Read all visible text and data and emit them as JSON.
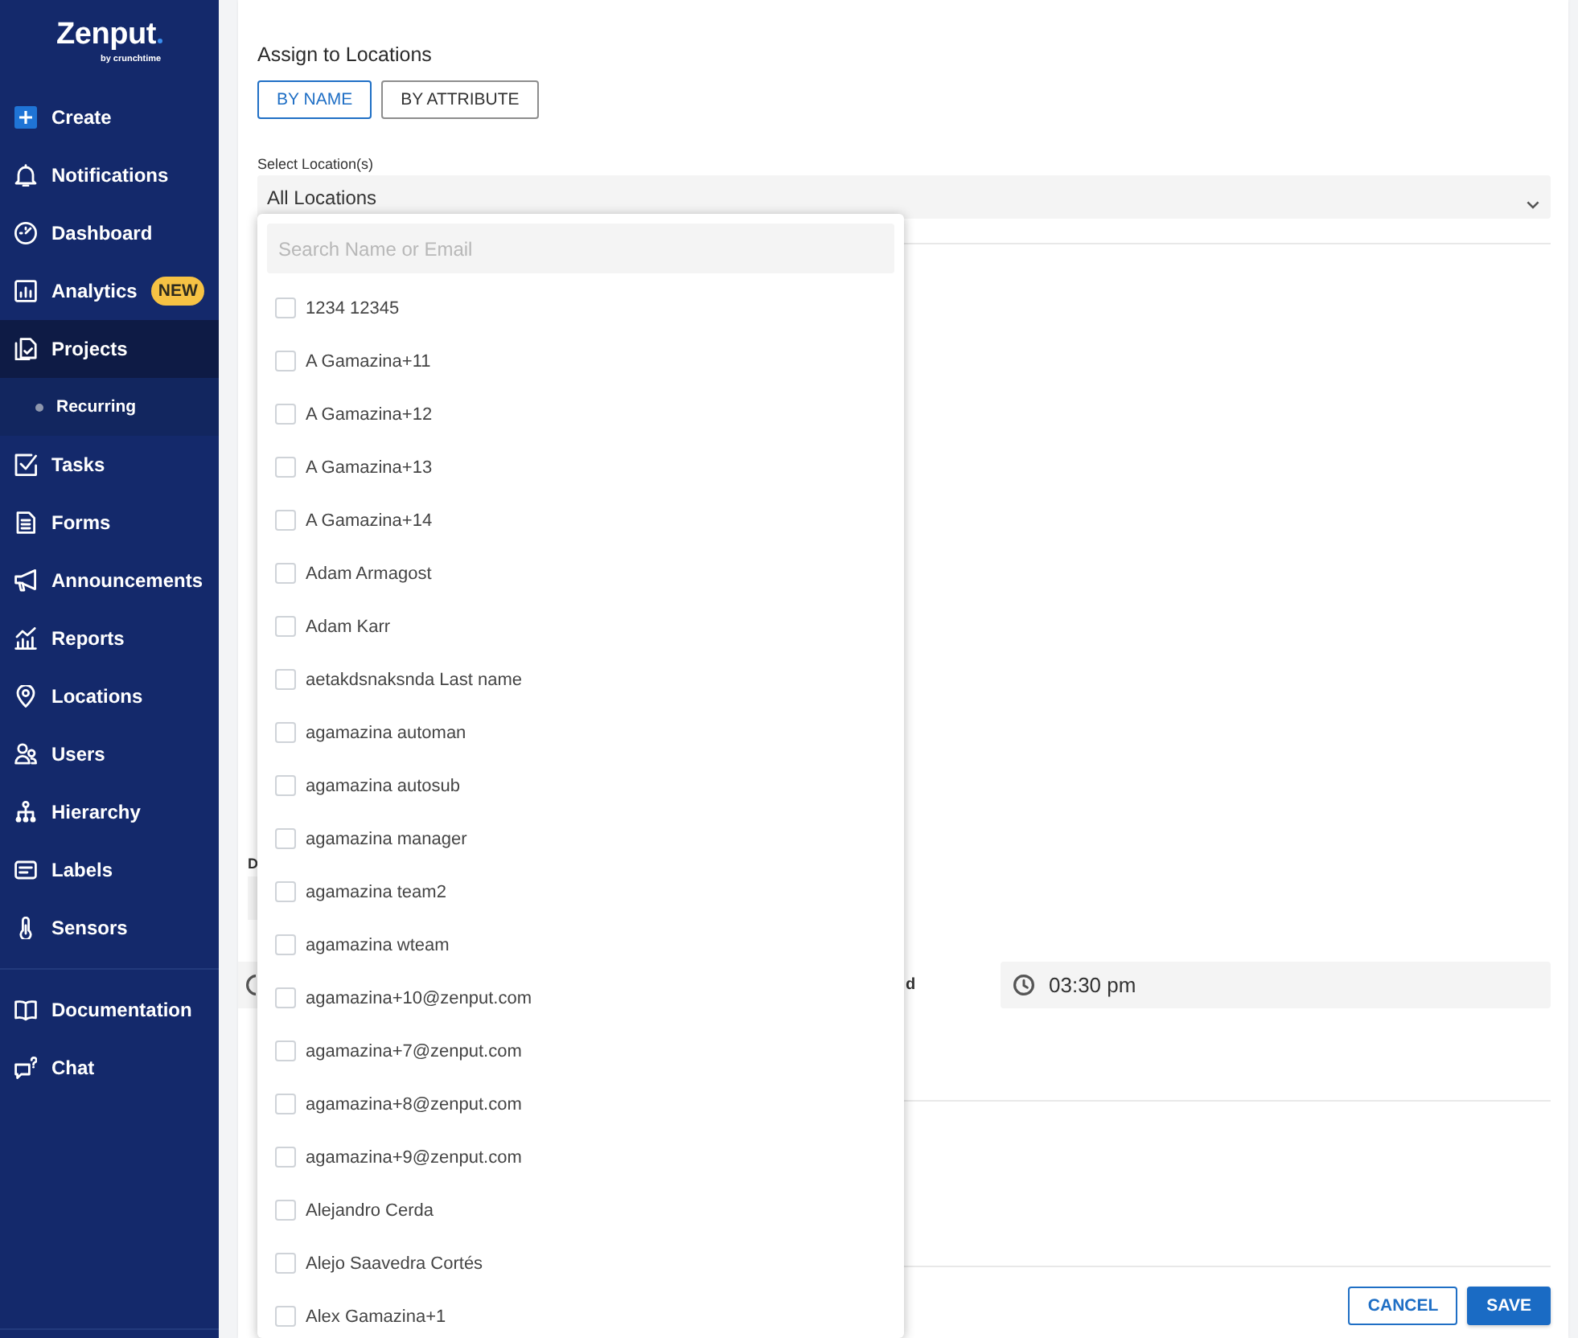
{
  "sidebar": {
    "logo": {
      "wordmark": "Zenput",
      "tagline": "by crunchtime"
    },
    "items": [
      {
        "label": "Create",
        "selected": false
      },
      {
        "label": "Notifications",
        "selected": false
      },
      {
        "label": "Dashboard",
        "selected": false
      },
      {
        "label": "Analytics",
        "selected": false,
        "badge": "NEW"
      },
      {
        "label": "Projects",
        "selected": true,
        "expanded": true,
        "children": [
          {
            "label": "Recurring",
            "selected": false
          }
        ]
      },
      {
        "label": "Tasks",
        "selected": false
      },
      {
        "label": "Forms",
        "selected": false
      },
      {
        "label": "Announcements",
        "selected": false
      },
      {
        "label": "Reports",
        "selected": false
      },
      {
        "label": "Locations",
        "selected": false
      },
      {
        "label": "Users",
        "selected": false
      },
      {
        "label": "Hierarchy",
        "selected": false
      },
      {
        "label": "Labels",
        "selected": false
      },
      {
        "label": "Sensors",
        "selected": false
      }
    ],
    "footer_items": [
      {
        "label": "Documentation"
      },
      {
        "label": "Chat"
      }
    ]
  },
  "assign": {
    "title": "Assign to Locations",
    "modes": [
      {
        "label": "BY NAME",
        "selected": true
      },
      {
        "label": "BY ATTRIBUTE",
        "selected": false
      }
    ],
    "select": {
      "label": "Select Location(s)",
      "value": "All Locations",
      "expanded": true
    }
  },
  "dropdown": {
    "search": {
      "placeholder": "Search Name or Email"
    },
    "options": [
      {
        "label": "1234 12345",
        "checked": false
      },
      {
        "label": "A Gamazina+11",
        "checked": false
      },
      {
        "label": "A Gamazina+12",
        "checked": false
      },
      {
        "label": "A Gamazina+13",
        "checked": false
      },
      {
        "label": "A Gamazina+14",
        "checked": false
      },
      {
        "label": "Adam Armagost",
        "checked": false
      },
      {
        "label": "Adam Karr",
        "checked": false
      },
      {
        "label": "aetakdsnaksnda Last name",
        "checked": false
      },
      {
        "label": "agamazina automan",
        "checked": false
      },
      {
        "label": "agamazina autosub",
        "checked": false
      },
      {
        "label": "agamazina manager",
        "checked": false
      },
      {
        "label": "agamazina team2",
        "checked": false
      },
      {
        "label": "agamazina wteam",
        "checked": false
      },
      {
        "label": "agamazina+10@zenput.com",
        "checked": false
      },
      {
        "label": "agamazina+7@zenput.com",
        "checked": false
      },
      {
        "label": "agamazina+8@zenput.com",
        "checked": false
      },
      {
        "label": "agamazina+9@zenput.com",
        "checked": false
      },
      {
        "label": "Alejandro Cerda",
        "checked": false
      },
      {
        "label": "Alejo Saavedra Cortés",
        "checked": false
      },
      {
        "label": "Alex Gamazina+1",
        "checked": false
      }
    ]
  },
  "schedule": {
    "label_1": "D",
    "label_2": "d",
    "end_time": "03:30 pm"
  },
  "actions": [
    {
      "label": "CANCEL",
      "kind": "secondary"
    },
    {
      "label": "SAVE",
      "kind": "primary"
    }
  ]
}
